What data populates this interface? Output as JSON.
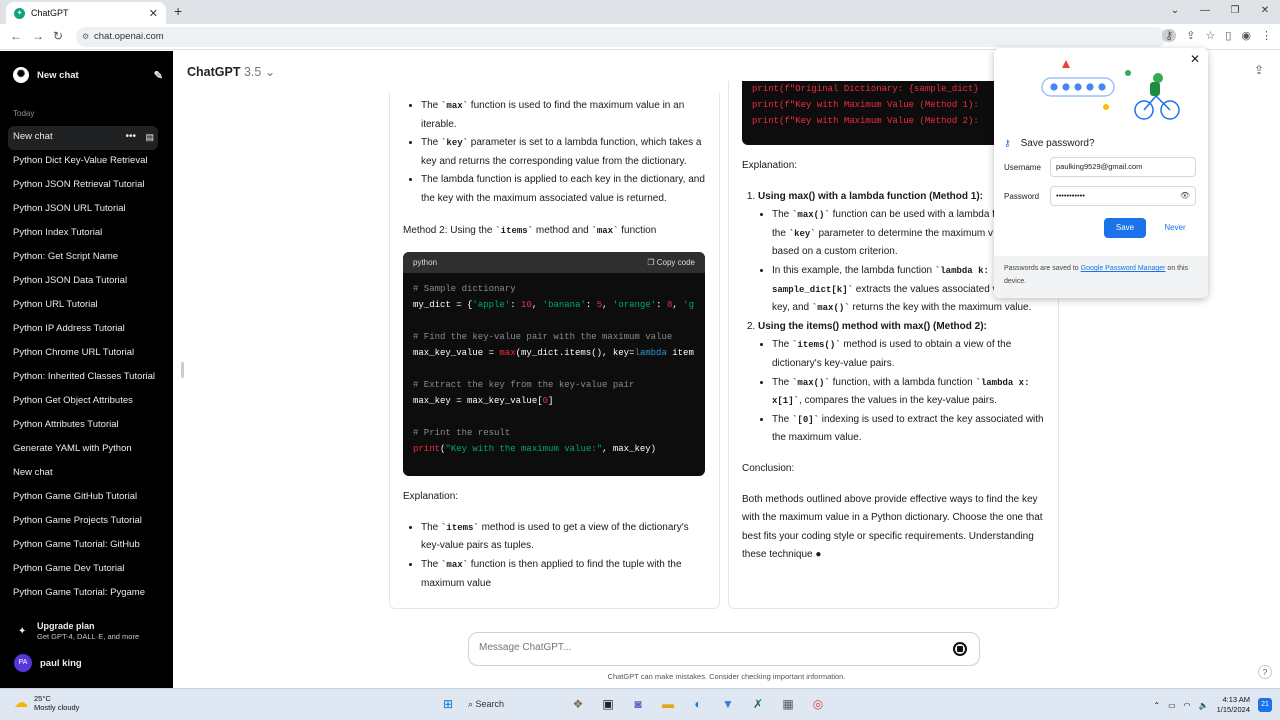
{
  "browser": {
    "tab_title": "ChatGPT",
    "url": "chat.openai.com"
  },
  "sidebar": {
    "new_chat": "New chat",
    "section": "Today",
    "items": [
      "New chat",
      "Python Dict Key-Value Retrieval",
      "Python JSON Retrieval Tutorial",
      "Python JSON URL Tutorial",
      "Python Index Tutorial",
      "Python: Get Script Name",
      "Python JSON Data Tutorial",
      "Python URL Tutorial",
      "Python IP Address Tutorial",
      "Python Chrome URL Tutorial",
      "Python: Inherited Classes Tutorial",
      "Python Get Object Attributes",
      "Python Attributes Tutorial",
      "Generate YAML with Python",
      "New chat",
      "Python Game GitHub Tutorial",
      "Python Game Projects Tutorial",
      "Python Game Tutorial: GitHub",
      "Python Game Dev Tutorial",
      "Python Game Tutorial: Pygame"
    ],
    "upgrade_title": "Upgrade plan",
    "upgrade_sub": "Get GPT-4, DALL·E, and more",
    "user_initials": "PA",
    "user_name": "paul king"
  },
  "main": {
    "model": "ChatGPT",
    "model_version": "3.5",
    "input_placeholder": "Message ChatGPT...",
    "disclaimer": "ChatGPT can make mistakes. Consider checking important information.",
    "help": "?"
  },
  "left_panel": {
    "b1_pre": "The ",
    "b1_code": "`max`",
    "b1_post": " function is used to find the maximum value in an iterable.",
    "b2_pre": "The ",
    "b2_code": "`key`",
    "b2_post": " parameter is set to a lambda function, which takes a key and returns the corresponding value from the dictionary.",
    "b3": "The lambda function is applied to each key in the dictionary, and the key with the maximum associated value is returned.",
    "m2_pre": "Method 2: Using the ",
    "m2_code1": "`items`",
    "m2_mid": " method and ",
    "m2_code2": "`max`",
    "m2_post": " function",
    "code_lang": "python",
    "copy_label": "Copy code",
    "explanation": "Explanation:",
    "e1_pre": "The ",
    "e1_code": "`items`",
    "e1_post": " method is used to get a view of the dictionary's key-value pairs as tuples.",
    "e2_pre": "The ",
    "e2_code": "`max`",
    "e2_post": " function is then applied to find the tuple with the maximum value"
  },
  "right_panel": {
    "code_lines": [
      "print(f\"Original Dictionary: {sample_dict}",
      "print(f\"Key with Maximum Value (Method 1):",
      "print(f\"Key with Maximum Value (Method 2):"
    ],
    "explanation": "Explanation:",
    "h1": "Using max() with a lambda function (Method 1):",
    "h1_b1_pre": "The ",
    "h1_b1_code1": "`max()`",
    "h1_b1_mid": " function can be used with a lambda f",
    "h1_b1_pre2": "the ",
    "h1_b1_code2": "`key`",
    "h1_b1_post": " parameter to determine the maximum v",
    "h1_b1_post2": "based on a custom criterion.",
    "h1_b2_pre": "In this example, the lambda function ",
    "h1_b2_code1": "`lambda k:",
    "h1_b2_code2": "sample_dict[k]`",
    "h1_b2_mid": " extracts the values associated v",
    "h1_b2_l3": "key, and ",
    "h1_b2_code3": "`max()`",
    "h1_b2_post": " returns the key with the maximum value.",
    "h2": "Using the items() method with max() (Method 2):",
    "h2_b1_pre": "The ",
    "h2_b1_code": "`items()`",
    "h2_b1_post": " method is used to obtain a view of the dictionary's key-value pairs.",
    "h2_b2_pre": "The ",
    "h2_b2_code": "`max()`",
    "h2_b2_mid": " function, with a lambda function ",
    "h2_b2_code2": "`lambda x:",
    "h2_b2_code3": "x[1]`",
    "h2_b2_post": ", compares the values in the key-value pairs.",
    "h2_b3_pre": "The ",
    "h2_b3_code": "`[0]`",
    "h2_b3_post": " indexing is used to extract the key associated with the maximum value.",
    "conclusion": "Conclusion:",
    "para": "Both methods outlined above provide effective ways to find the key with the maximum value in a Python dictionary. Choose the one that best fits your coding style or specific requirements. Understanding these technique"
  },
  "password_popup": {
    "title": "Save password?",
    "username_label": "Username",
    "username_value": "paulking9529@gmail.com",
    "password_label": "Password",
    "password_value": "•••••••••••",
    "save": "Save",
    "never": "Never",
    "foot_pre": "Passwords are saved to ",
    "foot_link": "Google Password Manager",
    "foot_post": " on this device."
  },
  "taskbar": {
    "temp": "25°C",
    "weather": "Mostly cloudy",
    "search": "Search",
    "time": "4:13 AM",
    "date": "1/15/2024",
    "badge": "21"
  },
  "colors": {
    "sidebar_bg": "#000000",
    "accent_blue": "#1a73e8",
    "code_bg": "#0d0d0d"
  }
}
